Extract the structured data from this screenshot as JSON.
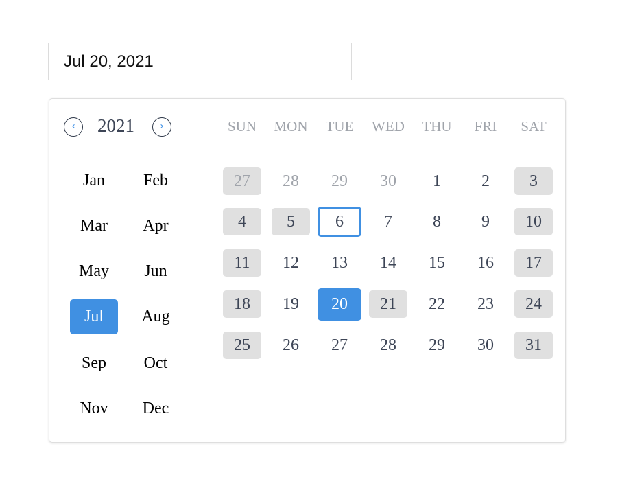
{
  "date_input": {
    "value": "Jul 20, 2021"
  },
  "year_nav": {
    "year": "2021",
    "prev_icon": "chevron-left-icon",
    "next_icon": "chevron-right-icon",
    "prev_glyph": "‹",
    "next_glyph": "›"
  },
  "months": [
    "Jan",
    "Feb",
    "Mar",
    "Apr",
    "May",
    "Jun",
    "Jul",
    "Aug",
    "Sep",
    "Oct",
    "Nov",
    "Dec"
  ],
  "selected_month": "Jul",
  "weekdays": [
    "SUN",
    "MON",
    "TUE",
    "WED",
    "THU",
    "FRI",
    "SAT"
  ],
  "days": [
    {
      "d": "27",
      "muted": true,
      "shaded": true
    },
    {
      "d": "28",
      "muted": true
    },
    {
      "d": "29",
      "muted": true
    },
    {
      "d": "30",
      "muted": true
    },
    {
      "d": "1"
    },
    {
      "d": "2"
    },
    {
      "d": "3",
      "shaded": true
    },
    {
      "d": "4",
      "shaded": true
    },
    {
      "d": "5",
      "shaded": true
    },
    {
      "d": "6",
      "today": true
    },
    {
      "d": "7"
    },
    {
      "d": "8"
    },
    {
      "d": "9"
    },
    {
      "d": "10",
      "shaded": true
    },
    {
      "d": "11",
      "shaded": true
    },
    {
      "d": "12"
    },
    {
      "d": "13"
    },
    {
      "d": "14"
    },
    {
      "d": "15"
    },
    {
      "d": "16"
    },
    {
      "d": "17",
      "shaded": true
    },
    {
      "d": "18",
      "shaded": true
    },
    {
      "d": "19"
    },
    {
      "d": "20",
      "selected": true
    },
    {
      "d": "21",
      "shaded": true
    },
    {
      "d": "22"
    },
    {
      "d": "23"
    },
    {
      "d": "24",
      "shaded": true
    },
    {
      "d": "25",
      "shaded": true
    },
    {
      "d": "26"
    },
    {
      "d": "27"
    },
    {
      "d": "28"
    },
    {
      "d": "29"
    },
    {
      "d": "30"
    },
    {
      "d": "31",
      "shaded": true
    }
  ],
  "colors": {
    "accent": "#4090e2",
    "shaded": "#e0e0e0",
    "muted": "#a0a4ab",
    "text": "#3d4556"
  }
}
